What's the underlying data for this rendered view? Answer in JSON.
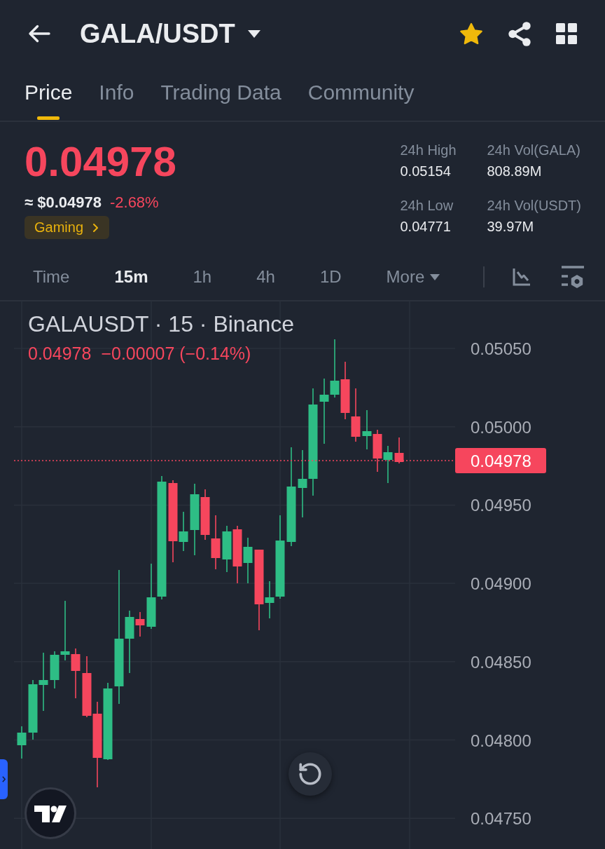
{
  "header": {
    "title": "GALA/USDT",
    "favorite": true
  },
  "tabs": [
    {
      "label": "Price",
      "selected": true
    },
    {
      "label": "Info",
      "selected": false
    },
    {
      "label": "Trading Data",
      "selected": false
    },
    {
      "label": "Community",
      "selected": false
    }
  ],
  "ticker": {
    "falling": true,
    "last_price": "0.04978",
    "usd_price": "≈ $0.04978",
    "change": "-2.68%",
    "category": "Gaming"
  },
  "stats": [
    {
      "label": "24h High",
      "value": "0.05154"
    },
    {
      "label": "24h Vol(GALA)",
      "value": "808.89M"
    },
    {
      "label": "24h Low",
      "value": "0.04771"
    },
    {
      "label": "24h Vol(USDT)",
      "value": "39.97M"
    }
  ],
  "intervals": [
    {
      "label": "Time",
      "selected": false
    },
    {
      "label": "15m",
      "selected": true
    },
    {
      "label": "1h",
      "selected": false
    },
    {
      "label": "4h",
      "selected": false
    },
    {
      "label": "1D",
      "selected": false
    }
  ],
  "more": {
    "label": "More"
  },
  "chart": {
    "legend": "GALAUSDT · 15 · Binance",
    "last": "0.04978",
    "change": "−0.00007 (−0.14%)",
    "falling": true,
    "price_axis": [
      "0.05050",
      "0.05000",
      "0.04950",
      "0.04900",
      "0.04850",
      "0.04800",
      "0.04750"
    ],
    "price_tag": "0.04978"
  }
}
